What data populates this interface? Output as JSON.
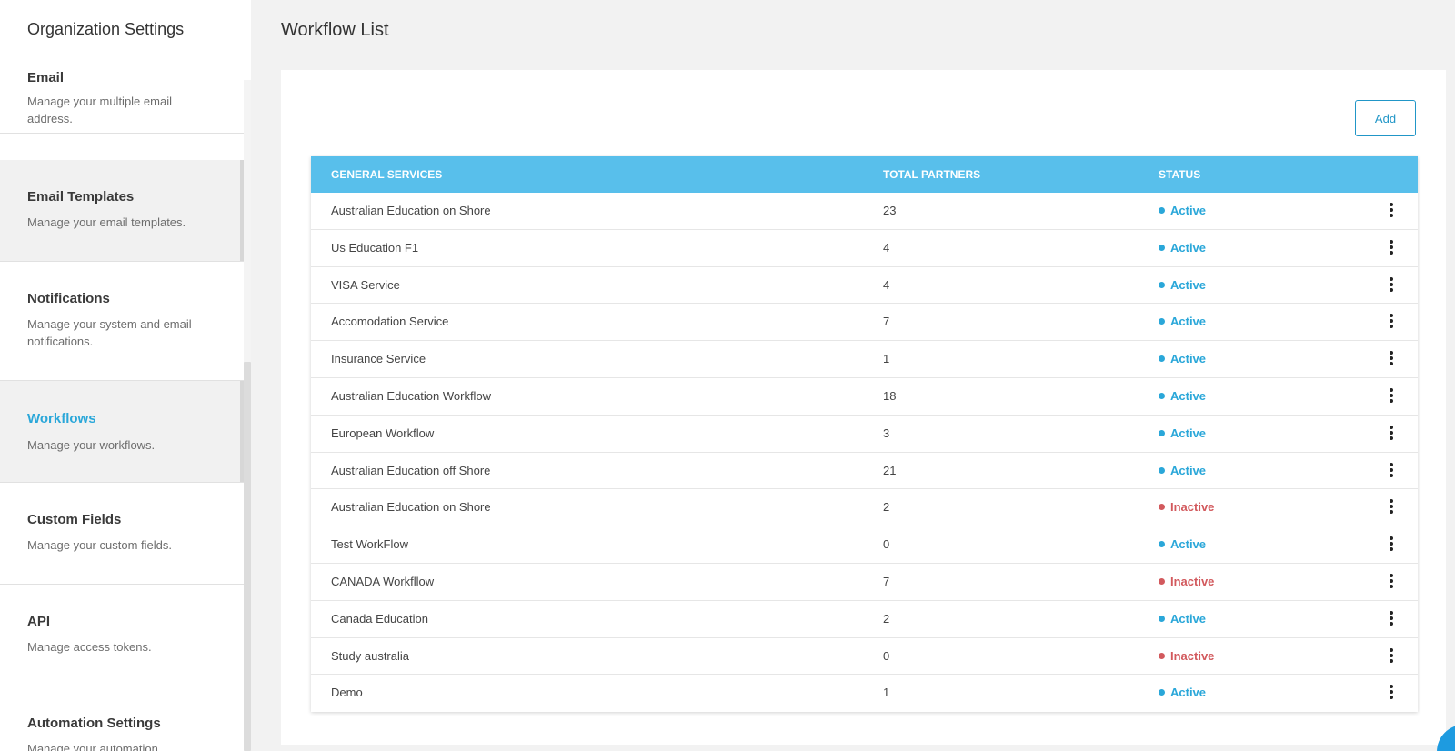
{
  "sidebar": {
    "title": "Organization Settings",
    "items": [
      {
        "label": "Email",
        "desc": "Manage your multiple email address."
      },
      {
        "label": "Email Templates",
        "desc": "Manage your email templates."
      },
      {
        "label": "Notifications",
        "desc": "Manage your system and email notifications."
      },
      {
        "label": "Workflows",
        "desc": "Manage your workflows."
      },
      {
        "label": "Custom Fields",
        "desc": "Manage your custom fields."
      },
      {
        "label": "API",
        "desc": "Manage access tokens."
      },
      {
        "label": "Automation Settings",
        "desc": "Manage your automation"
      }
    ]
  },
  "main": {
    "title": "Workflow List",
    "add_label": "Add",
    "table": {
      "headers": [
        "GENERAL SERVICES",
        "TOTAL PARTNERS",
        "STATUS"
      ],
      "rows": [
        {
          "name": "Australian Education on Shore",
          "total": "23",
          "status": "Active"
        },
        {
          "name": "Us Education F1",
          "total": "4",
          "status": "Active"
        },
        {
          "name": "VISA Service",
          "total": "4",
          "status": "Active"
        },
        {
          "name": "Accomodation Service",
          "total": "7",
          "status": "Active"
        },
        {
          "name": "Insurance Service",
          "total": "1",
          "status": "Active"
        },
        {
          "name": "Australian Education Workflow",
          "total": "18",
          "status": "Active"
        },
        {
          "name": "European Workflow",
          "total": "3",
          "status": "Active"
        },
        {
          "name": "Australian Education off Shore",
          "total": "21",
          "status": "Active"
        },
        {
          "name": "Australian Education on Shore",
          "total": "2",
          "status": "Inactive"
        },
        {
          "name": "Test WorkFlow",
          "total": "0",
          "status": "Active"
        },
        {
          "name": "CANADA Workfllow",
          "total": "7",
          "status": "Inactive"
        },
        {
          "name": "Canada Education",
          "total": "2",
          "status": "Active"
        },
        {
          "name": "Study australia",
          "total": "0",
          "status": "Inactive"
        },
        {
          "name": "Demo",
          "total": "1",
          "status": "Active"
        }
      ]
    }
  },
  "colors": {
    "accent": "#2aa7d9",
    "header_bg": "#58bfeb",
    "inactive": "#d2595d"
  },
  "icons": {
    "row_menu": "more-vertical-icon",
    "status": "status-dot-icon"
  }
}
